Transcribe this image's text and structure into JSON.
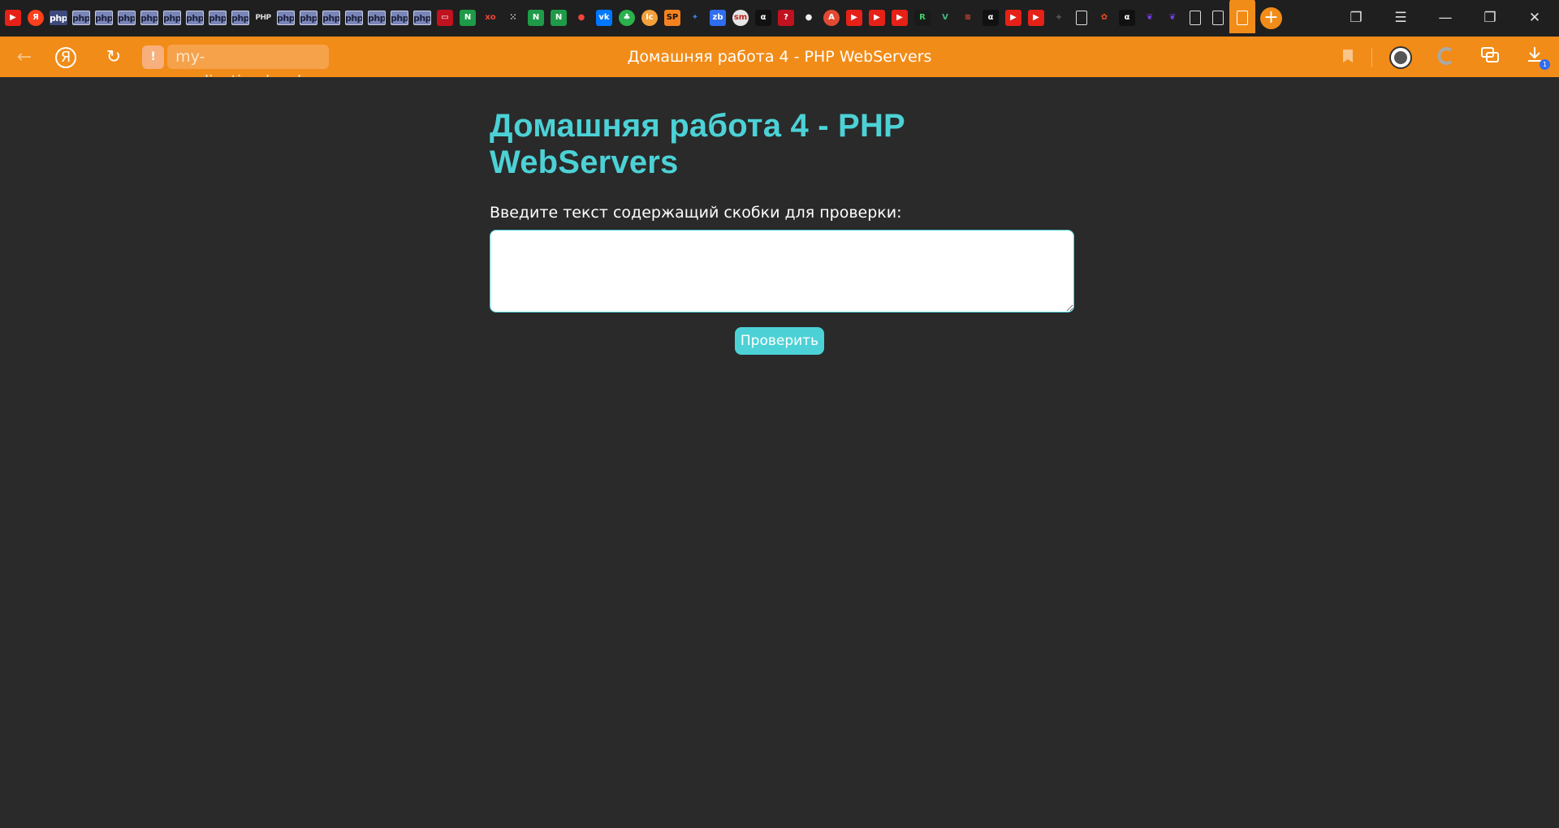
{
  "tabs": [
    {
      "icon": "youtube-icon",
      "glyph": "▶",
      "bg": "#e62117",
      "shape": "rounded"
    },
    {
      "icon": "yandex-icon",
      "glyph": "Я",
      "bg": "#fc3f1d",
      "shape": "circle"
    },
    {
      "icon": "php-icon",
      "glyph": "php",
      "style": "dark"
    },
    {
      "icon": "php-icon",
      "glyph": "php",
      "style": "light"
    },
    {
      "icon": "php-icon",
      "glyph": "php",
      "style": "light"
    },
    {
      "icon": "php-icon",
      "glyph": "php",
      "style": "light"
    },
    {
      "icon": "php-icon",
      "glyph": "php",
      "style": "light"
    },
    {
      "icon": "php-icon",
      "glyph": "php",
      "style": "light"
    },
    {
      "icon": "php-icon",
      "glyph": "php",
      "style": "light"
    },
    {
      "icon": "php-icon",
      "glyph": "php",
      "style": "light"
    },
    {
      "icon": "php-icon",
      "glyph": "php",
      "style": "light"
    },
    {
      "icon": "php-icon",
      "glyph": "PHP",
      "style": "grey"
    },
    {
      "icon": "php-icon",
      "glyph": "php",
      "style": "light"
    },
    {
      "icon": "php-icon",
      "glyph": "php",
      "style": "light"
    },
    {
      "icon": "php-icon",
      "glyph": "php",
      "style": "light"
    },
    {
      "icon": "php-icon",
      "glyph": "php",
      "style": "light"
    },
    {
      "icon": "php-icon",
      "glyph": "php",
      "style": "light"
    },
    {
      "icon": "php-icon",
      "glyph": "php",
      "style": "light"
    },
    {
      "icon": "php-icon",
      "glyph": "php",
      "style": "light"
    },
    {
      "icon": "monitor-icon",
      "glyph": "▭",
      "bg": "#c1121f",
      "shape": "rounded"
    },
    {
      "icon": "nginx-icon",
      "glyph": "N",
      "bg": "#1f9a48",
      "shape": "rounded"
    },
    {
      "icon": "xo-icon",
      "glyph": "xo",
      "bg": "transparent",
      "color": "#f0453a",
      "shape": "rounded"
    },
    {
      "icon": "dots-icon",
      "glyph": "⁙",
      "bg": "transparent",
      "color": "#eee",
      "shape": "rounded"
    },
    {
      "icon": "nginx-icon",
      "glyph": "N",
      "bg": "#1f9a48",
      "shape": "rounded"
    },
    {
      "icon": "nginx-icon",
      "glyph": "N",
      "bg": "#1f9a48",
      "shape": "rounded"
    },
    {
      "icon": "map-pin-icon",
      "glyph": "●",
      "bg": "transparent",
      "color": "#f0453a",
      "shape": "rounded"
    },
    {
      "icon": "vk-icon",
      "glyph": "vk",
      "bg": "#0077ff",
      "shape": "rounded"
    },
    {
      "icon": "tree-icon",
      "glyph": "♣",
      "bg": "#2bb24c",
      "shape": "circle"
    },
    {
      "icon": "lc-icon",
      "glyph": "lc",
      "bg": "#f5a03a",
      "shape": "circle"
    },
    {
      "icon": "sp-icon",
      "glyph": "SP",
      "bg": "#f58220",
      "color": "#111",
      "shape": "rounded"
    },
    {
      "icon": "bird-icon",
      "glyph": "✦",
      "bg": "transparent",
      "color": "#3d7be0",
      "shape": "rounded"
    },
    {
      "icon": "zb-icon",
      "glyph": "zb",
      "bg": "#2f6df1",
      "shape": "rounded"
    },
    {
      "icon": "sm-icon",
      "glyph": "sm",
      "bg": "#e6e6e6",
      "color": "#c0261c",
      "shape": "circle"
    },
    {
      "icon": "alpha-icon",
      "glyph": "α",
      "bg": "#111",
      "shape": "rounded"
    },
    {
      "icon": "question-icon",
      "glyph": "?",
      "bg": "#c1121f",
      "shape": "rounded"
    },
    {
      "icon": "github-icon",
      "glyph": "●",
      "bg": "transparent",
      "color": "#eee",
      "shape": "circle"
    },
    {
      "icon": "translate-icon",
      "glyph": "A",
      "bg": "#e24a33",
      "shape": "circle"
    },
    {
      "icon": "youtube-icon",
      "glyph": "▶",
      "bg": "#e62117",
      "shape": "rounded"
    },
    {
      "icon": "youtube-icon",
      "glyph": "▶",
      "bg": "#e62117",
      "shape": "rounded"
    },
    {
      "icon": "youtube-icon",
      "glyph": "▶",
      "bg": "#e62117",
      "shape": "rounded"
    },
    {
      "icon": "rb-icon",
      "glyph": "R",
      "bg": "#1a1a1a",
      "color": "#3fd16b",
      "shape": "rounded"
    },
    {
      "icon": "vue-icon",
      "glyph": "V",
      "bg": "transparent",
      "color": "#41b883",
      "shape": "rounded"
    },
    {
      "icon": "fish-icon",
      "glyph": "≋",
      "bg": "transparent",
      "color": "#e24a33",
      "shape": "rounded"
    },
    {
      "icon": "alpha-icon",
      "glyph": "α",
      "bg": "#111",
      "shape": "rounded"
    },
    {
      "icon": "youtube-icon",
      "glyph": "▶",
      "bg": "#e62117",
      "shape": "rounded"
    },
    {
      "icon": "youtube-icon",
      "glyph": "▶",
      "bg": "#e62117",
      "shape": "rounded"
    },
    {
      "icon": "plus-icon",
      "glyph": "+",
      "bg": "transparent",
      "color": "#666",
      "shape": "rounded"
    },
    {
      "icon": "document-icon",
      "glyph": "",
      "style": "doc"
    },
    {
      "icon": "figma-icon",
      "glyph": "✿",
      "bg": "transparent",
      "color": "#f24e1e",
      "shape": "rounded"
    },
    {
      "icon": "alpha-icon",
      "glyph": "α",
      "bg": "#111",
      "shape": "rounded"
    },
    {
      "icon": "feather-icon",
      "glyph": "❦",
      "bg": "transparent",
      "color": "#7b3ff2",
      "shape": "rounded"
    },
    {
      "icon": "feather-icon",
      "glyph": "❦",
      "bg": "transparent",
      "color": "#7b3ff2",
      "shape": "rounded"
    },
    {
      "icon": "document-icon",
      "glyph": "",
      "style": "doc"
    },
    {
      "icon": "document-icon",
      "glyph": "",
      "style": "doc"
    },
    {
      "icon": "document-icon",
      "glyph": "",
      "style": "doc",
      "active": true
    }
  ],
  "window_controls": {
    "collections": "❐",
    "menu": "☰",
    "minimize": "—",
    "restore": "❐",
    "close": "✕"
  },
  "toolbar": {
    "back": "←",
    "yandex": "Я",
    "reload": "↻",
    "warning": "!",
    "url": "my-application.local",
    "title": "Домашняя работа 4 - PHP WebServers",
    "bookmark": "🔖",
    "download_badge": "1"
  },
  "page": {
    "heading": "Домашняя работа 4 - PHP WebServers",
    "label": "Введите текст содержащий скобки для проверки:",
    "textarea_value": "",
    "submit_label": "Проверить"
  },
  "colors": {
    "accent": "#4cd2d6",
    "browser_orange": "#f28c18",
    "page_background": "#2a2a2a"
  }
}
